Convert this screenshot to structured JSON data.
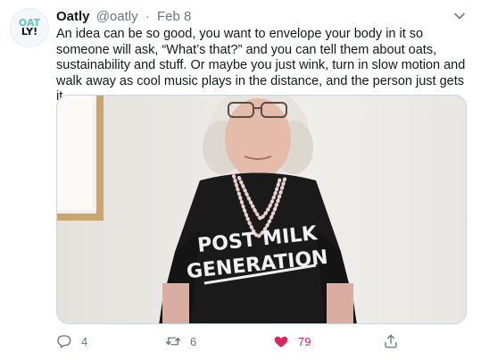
{
  "tweet": {
    "author_name": "Oatly",
    "author_handle": "@oatly",
    "separator": "·",
    "date": "Feb 8",
    "text": "An idea can be so good, you want to envelope your body in it so someone will ask, “What’s that?” and you can tell them about oats, sustainability and stuff. Or maybe you just wink, turn in slow motion and walk away as cool music plays in the distance, and the person just gets it.",
    "avatar_logo_top": "OAT",
    "avatar_logo_bottom": "LY!",
    "media": {
      "shirt_line_1": "POST MILK",
      "shirt_line_2": "GENERATION"
    },
    "actions": {
      "reply_count": "4",
      "retweet_count": "6",
      "like_count": "79"
    }
  },
  "colors": {
    "text_primary": "#14171a",
    "text_secondary": "#657786",
    "like_active": "#e0245e",
    "border": "#ccd6dd",
    "avatar_accent": "#5fc2c9"
  },
  "icons": [
    "chevron-down-icon",
    "reply-icon",
    "retweet-icon",
    "like-icon",
    "share-icon"
  ]
}
